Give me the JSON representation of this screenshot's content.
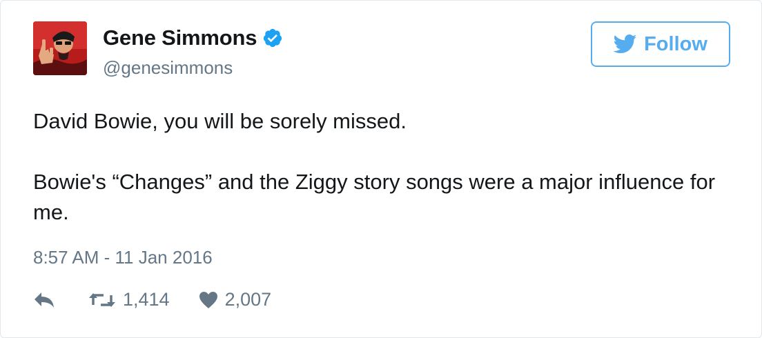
{
  "tweet": {
    "author": {
      "display_name": "Gene Simmons",
      "handle": "@genesimmons",
      "verified": true,
      "avatar_icon": "profile-photo"
    },
    "follow_button": {
      "label": "Follow",
      "icon": "twitter-bird-icon",
      "accent_color": "#55acee"
    },
    "text_lines": [
      "David Bowie, you will be sorely missed.",
      "Bowie's “Changes” and the Ziggy story songs were a major influence for me."
    ],
    "timestamp": "8:57 AM - 11 Jan 2016",
    "actions": {
      "reply_icon": "reply-icon",
      "retweet_icon": "retweet-icon",
      "retweet_count": "1,414",
      "like_icon": "heart-icon",
      "like_count": "2,007"
    }
  },
  "colors": {
    "text_primary": "#14171a",
    "text_secondary": "#657786",
    "accent": "#55acee",
    "verified_badge": "#1da1f2",
    "border": "#e1e8ed"
  }
}
